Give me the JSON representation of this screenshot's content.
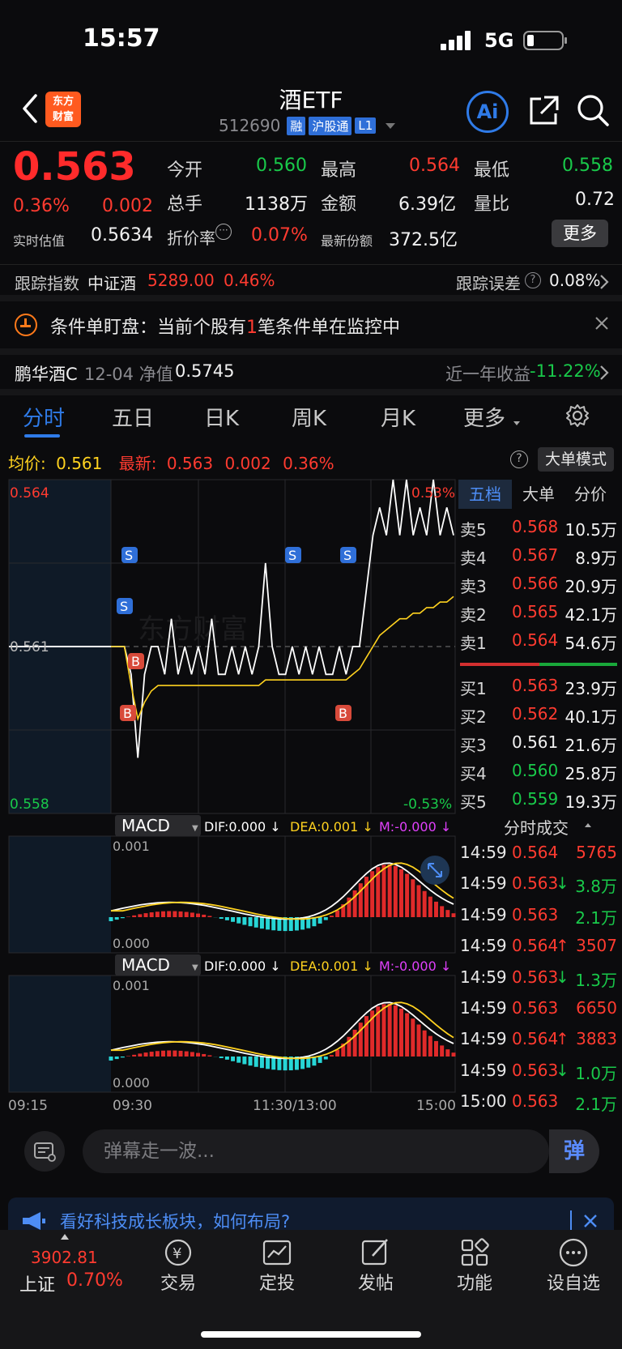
{
  "status_bar": {
    "time": "15:57",
    "network": "5G"
  },
  "header": {
    "logo_text_1": "东方",
    "logo_text_2": "财富",
    "title": "酒ETF",
    "code": "512690",
    "tags": [
      "融",
      "沪股通",
      "L1"
    ],
    "ai_label": "Ai"
  },
  "quote": {
    "price": "0.563",
    "change_pct": "0.36%",
    "change": "0.002",
    "est_label": "实时估值",
    "est_value": "0.5634",
    "open_label": "今开",
    "open_value": "0.560",
    "high_label": "最高",
    "high_value": "0.564",
    "low_label": "最低",
    "low_value": "0.558",
    "volume_label": "总手",
    "volume_value": "1138万",
    "amount_label": "金额",
    "amount_value": "6.39亿",
    "ratio_label": "量比",
    "ratio_value": "0.72",
    "discount_label": "折价率",
    "discount_value": "0.07%",
    "shares_label": "最新份额",
    "shares_value": "372.5亿",
    "more_label": "更多"
  },
  "tracking": {
    "label": "跟踪指数",
    "index_name": "中证酒",
    "index_value": "5289.00",
    "index_change": "0.46%",
    "error_label": "跟踪误差",
    "error_value": "0.08%"
  },
  "condition_order": {
    "prefix": "条件单盯盘：当前个股有",
    "count": "1",
    "suffix": "笔条件单在监控中"
  },
  "fund": {
    "name": "鹏华酒C",
    "date_label": "12-04 净值",
    "nav": "0.5745",
    "return_label": "近一年收益",
    "return_value": "-11.22%"
  },
  "tabs": [
    "分时",
    "五日",
    "日K",
    "周K",
    "月K",
    "更多"
  ],
  "info_bar": {
    "avg_label": "均价:",
    "avg_value": "0.561",
    "latest_label": "最新:",
    "latest_value": "0.563",
    "latest_change": "0.002",
    "latest_pct": "0.36%",
    "mode_label": "大单模式"
  },
  "chart_labels": {
    "high": "0.564",
    "mid": "0.561",
    "low": "0.558",
    "high_pct": "0.53%",
    "low_pct": "-0.53%",
    "time_start": "09:15",
    "time_open": "09:30",
    "time_mid": "11:30/13:00",
    "time_end": "15:00"
  },
  "chart_data": {
    "type": "line",
    "series": [
      {
        "name": "price",
        "color": "#ffffff",
        "values": [
          0.561,
          0.561,
          0.561,
          0.5605,
          0.559,
          0.5605,
          0.561,
          0.561,
          0.5605,
          0.5615,
          0.5605,
          0.561,
          0.5605,
          0.561,
          0.5605,
          0.5615,
          0.5605,
          0.5605,
          0.561,
          0.5605,
          0.561,
          0.5605,
          0.561,
          0.5625,
          0.561,
          0.5605,
          0.5605,
          0.561,
          0.5605,
          0.561,
          0.5605,
          0.561,
          0.5605,
          0.5605,
          0.561,
          0.5605,
          0.561,
          0.561,
          0.562,
          0.563,
          0.5635,
          0.563,
          0.564,
          0.563,
          0.564,
          0.563,
          0.5635,
          0.563,
          0.564,
          0.563,
          0.5635,
          0.563
        ]
      },
      {
        "name": "avg",
        "color": "#ffd21f",
        "values": [
          0.561,
          0.561,
          0.561,
          0.5603,
          0.5597,
          0.56,
          0.5602,
          0.5603,
          0.5603,
          0.5603,
          0.5603,
          0.5603,
          0.5603,
          0.5603,
          0.5603,
          0.5603,
          0.5603,
          0.5603,
          0.5603,
          0.5603,
          0.5603,
          0.5603,
          0.5603,
          0.5604,
          0.5604,
          0.5604,
          0.5604,
          0.5604,
          0.5604,
          0.5604,
          0.5604,
          0.5604,
          0.5604,
          0.5604,
          0.5604,
          0.5604,
          0.5605,
          0.5606,
          0.5608,
          0.561,
          0.5612,
          0.5613,
          0.5614,
          0.5615,
          0.5615,
          0.5616,
          0.5616,
          0.5617,
          0.5617,
          0.5618,
          0.5618,
          0.5619
        ]
      }
    ],
    "ylim": [
      0.558,
      0.564
    ]
  },
  "order_book": {
    "tabs": [
      "五档",
      "大单",
      "分价"
    ],
    "asks": [
      {
        "label": "卖5",
        "price": "0.568",
        "vol": "10.5万",
        "color": "#ff3b30"
      },
      {
        "label": "卖4",
        "price": "0.567",
        "vol": "8.9万",
        "color": "#ff3b30"
      },
      {
        "label": "卖3",
        "price": "0.566",
        "vol": "20.9万",
        "color": "#ff3b30"
      },
      {
        "label": "卖2",
        "price": "0.565",
        "vol": "42.1万",
        "color": "#ff3b30"
      },
      {
        "label": "卖1",
        "price": "0.564",
        "vol": "54.6万",
        "color": "#ff3b30"
      }
    ],
    "bids": [
      {
        "label": "买1",
        "price": "0.563",
        "vol": "23.9万",
        "color": "#ff3b30"
      },
      {
        "label": "买2",
        "price": "0.562",
        "vol": "40.1万",
        "color": "#ff3b30"
      },
      {
        "label": "买3",
        "price": "0.561",
        "vol": "21.6万",
        "color": "#f2f2f2"
      },
      {
        "label": "买4",
        "price": "0.560",
        "vol": "25.8万",
        "color": "#19c94a"
      },
      {
        "label": "买5",
        "price": "0.559",
        "vol": "19.3万",
        "color": "#19c94a"
      }
    ]
  },
  "trades": {
    "title": "分时成交",
    "rows": [
      {
        "time": "14:59",
        "price": "0.564",
        "arrow": "",
        "vol": "5765",
        "vcolor": "#ff3b30"
      },
      {
        "time": "14:59",
        "price": "0.563",
        "arrow": "↓",
        "vol": "3.8万",
        "vcolor": "#19c94a"
      },
      {
        "time": "14:59",
        "price": "0.563",
        "arrow": "",
        "vol": "2.1万",
        "vcolor": "#19c94a"
      },
      {
        "time": "14:59",
        "price": "0.564",
        "arrow": "↑",
        "vol": "3507",
        "vcolor": "#ff3b30"
      },
      {
        "time": "14:59",
        "price": "0.563",
        "arrow": "↓",
        "vol": "1.3万",
        "vcolor": "#19c94a"
      },
      {
        "time": "14:59",
        "price": "0.563",
        "arrow": "",
        "vol": "6650",
        "vcolor": "#ff3b30"
      },
      {
        "time": "14:59",
        "price": "0.564",
        "arrow": "↑",
        "vol": "3883",
        "vcolor": "#ff3b30"
      },
      {
        "time": "14:59",
        "price": "0.563",
        "arrow": "↓",
        "vol": "1.0万",
        "vcolor": "#19c94a"
      },
      {
        "time": "15:00",
        "price": "0.563",
        "arrow": "",
        "vol": "2.1万",
        "vcolor": "#19c94a"
      }
    ]
  },
  "macd": {
    "name": "MACD",
    "dif": "DIF:0.000 ↓",
    "dea": "DEA:0.001 ↓",
    "m": "M:-0.000 ↓",
    "top_label": "0.001",
    "bottom_label": "0.000"
  },
  "danmu": {
    "placeholder": "弹幕走一波...",
    "send": "弹"
  },
  "ad": {
    "text": "看好科技成长板块，如何布局?"
  },
  "nav": {
    "index_value": "3902.81",
    "index_name": "上证",
    "index_pct": "0.70%",
    "items": [
      "交易",
      "定投",
      "发帖",
      "功能",
      "设自选"
    ]
  }
}
